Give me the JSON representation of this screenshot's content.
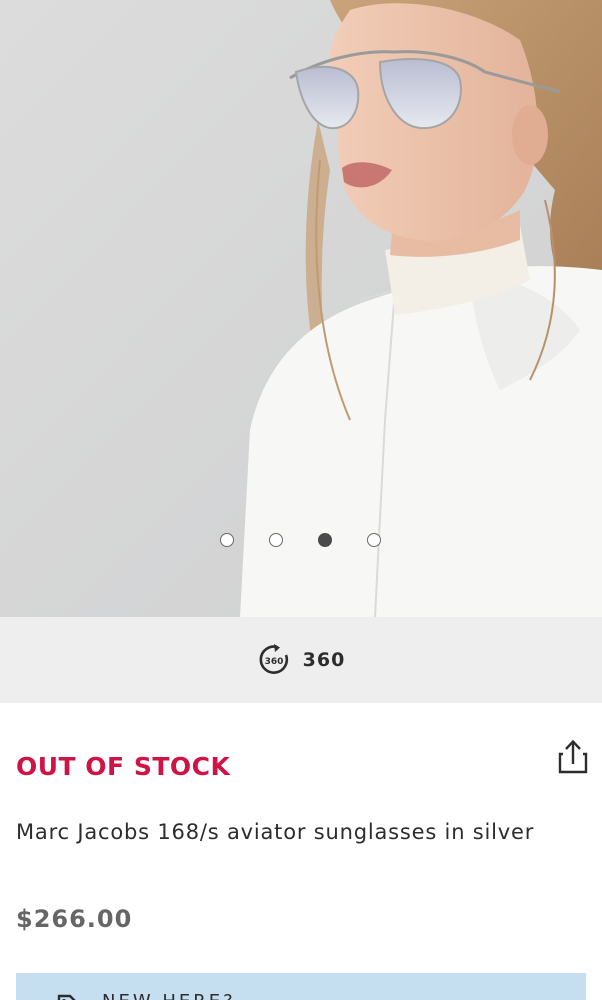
{
  "gallery": {
    "slide_count": 4,
    "active_index": 2
  },
  "view360": {
    "icon": "rotate-360-icon",
    "icon_text": "360",
    "label": "360"
  },
  "product": {
    "stock_status": "OUT OF STOCK",
    "title": "Marc Jacobs 168/s aviator sunglasses in silver",
    "price": "$266.00",
    "share_icon": "share-icon"
  },
  "banner": {
    "text": "NEW HERE?",
    "icon": "tag-icon"
  },
  "colors": {
    "stock_status": "#d01345",
    "price": "#666666",
    "banner_bg": "#c6dff0",
    "bar360_bg": "#eeeeee"
  }
}
